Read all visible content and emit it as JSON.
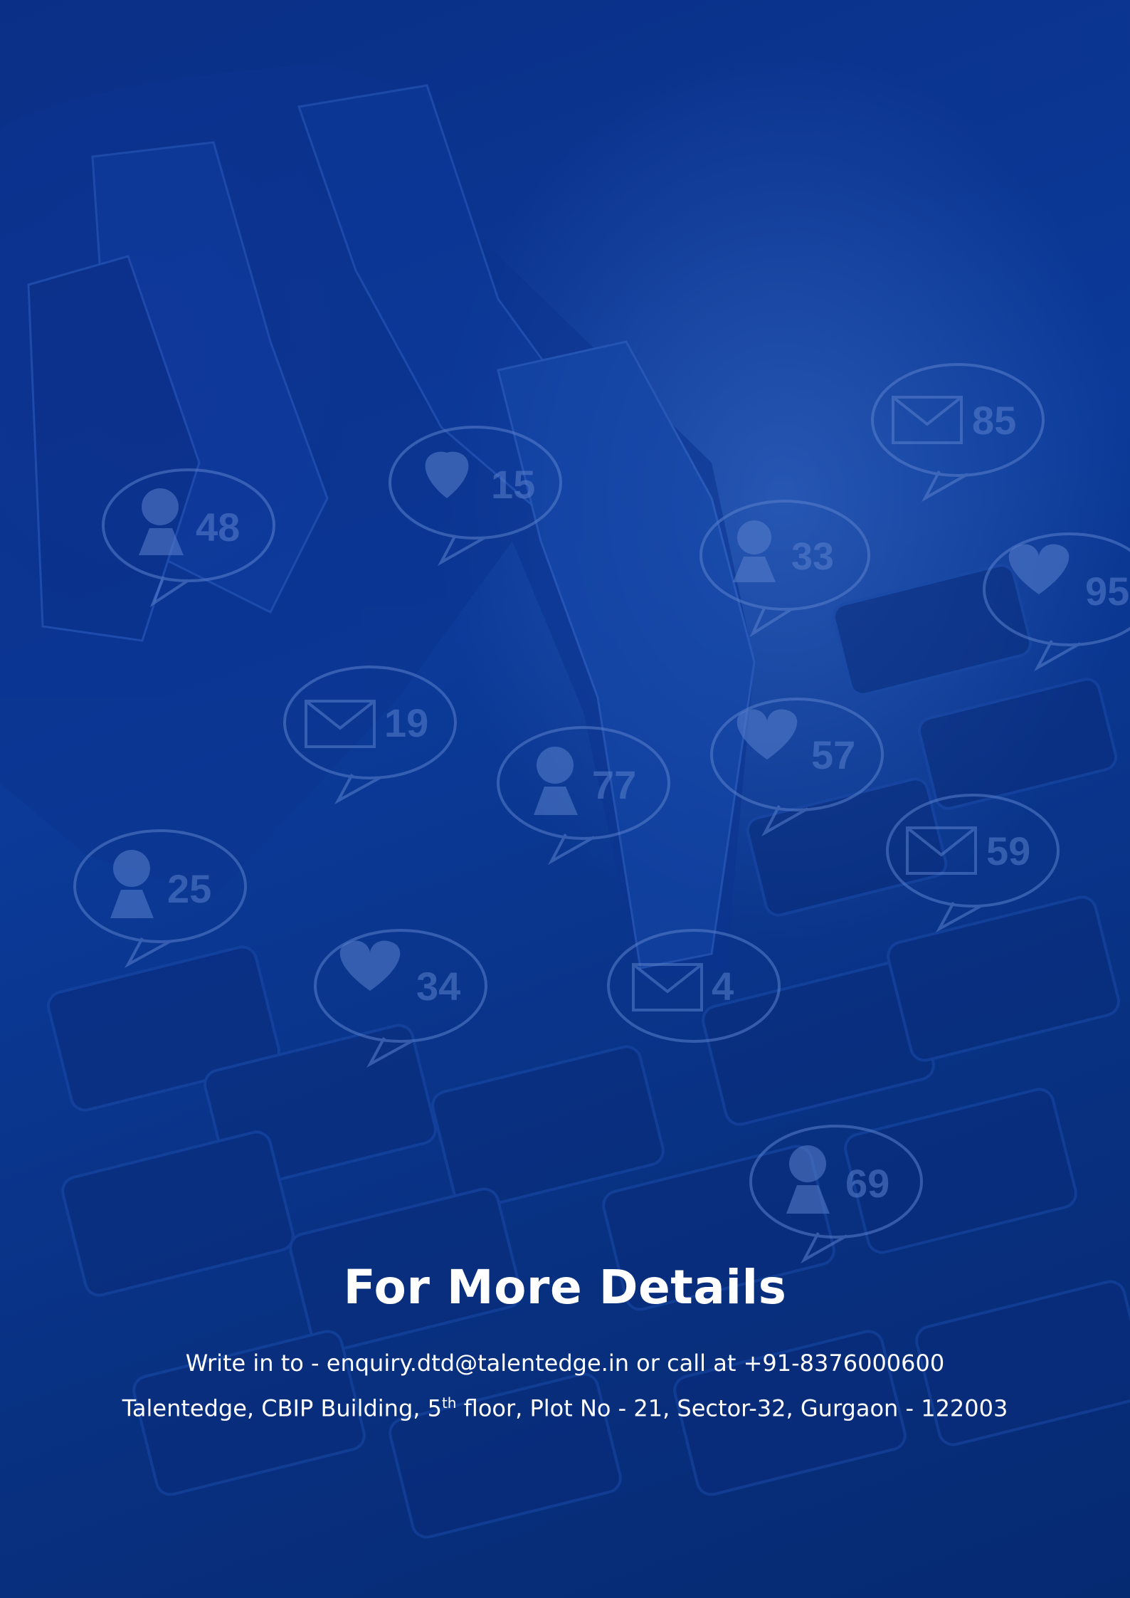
{
  "footer": {
    "title": "For More Details",
    "contact_prefix": "Write in to - ",
    "email": "enquiry.dtd@talentedge.in",
    "contact_middle": " or call at ",
    "phone": "+91-8376000600",
    "address_part1": "Talentedge, CBIP Building, 5",
    "address_sup": "th",
    "address_part2": " floor, Plot No - 21, Sector-32, Gurgaon - 122003"
  },
  "bubbles": [
    {
      "icon": "user-icon",
      "count": "48"
    },
    {
      "icon": "heart-icon",
      "count": "15"
    },
    {
      "icon": "mail-icon",
      "count": "85"
    },
    {
      "icon": "user-icon",
      "count": "33"
    },
    {
      "icon": "heart-icon",
      "count": "95"
    },
    {
      "icon": "mail-icon",
      "count": "19"
    },
    {
      "icon": "user-icon",
      "count": "77"
    },
    {
      "icon": "heart-icon",
      "count": "57"
    },
    {
      "icon": "mail-icon",
      "count": "59"
    },
    {
      "icon": "user-icon",
      "count": "25"
    },
    {
      "icon": "heart-icon",
      "count": "34"
    },
    {
      "icon": "mail-icon",
      "count": "4"
    },
    {
      "icon": "user-icon",
      "count": "69"
    }
  ],
  "colors": {
    "background": "#0b3a99",
    "text": "#ffffff",
    "bubble_stroke": "#5a80cc"
  }
}
